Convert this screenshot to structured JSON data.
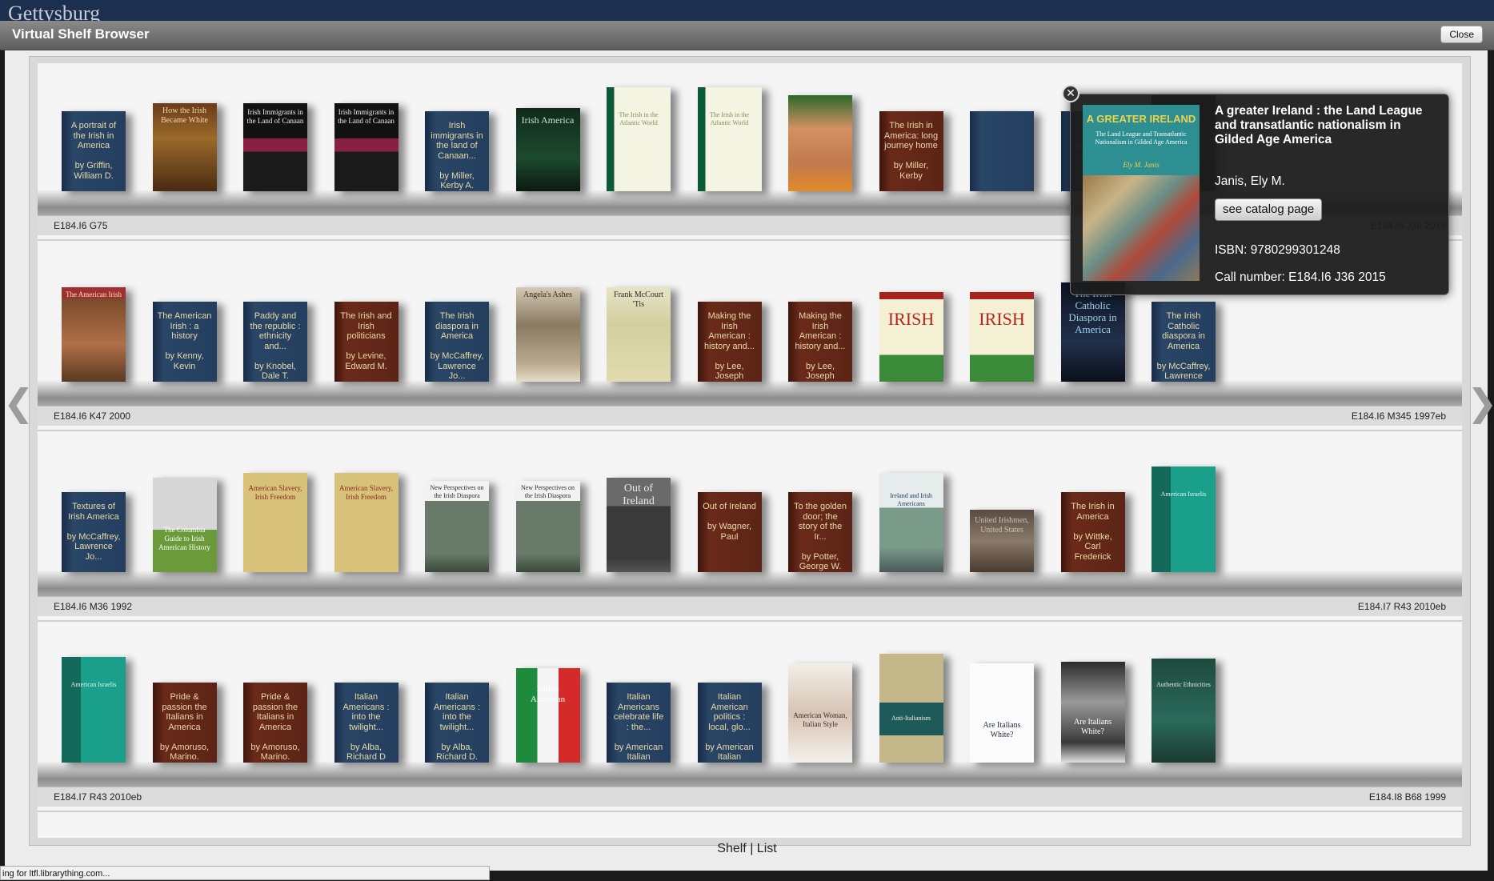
{
  "header": {
    "brand": "Gettysburg"
  },
  "dialog": {
    "title": "Virtual Shelf Browser",
    "close_label": "Close"
  },
  "shelves": [
    {
      "left_callno": "E184.I6 G75",
      "right_callno": "E184.I6 J36 2015",
      "books": [
        {
          "text": "A portrait of the Irish in America\n\nby Griffin, William D.",
          "color": "blue"
        },
        {
          "cover": "How the Irish Became White",
          "style": "brown-photo"
        },
        {
          "cover": "Irish Immigrants in the Land of Canaan",
          "style": "dark-band"
        },
        {
          "cover": "Irish Immigrants in the Land of Canaan",
          "style": "dark-band"
        },
        {
          "text": "Irish immigrants in the land of Canaan...\n\nby Miller, Kerby A.",
          "color": "blue"
        },
        {
          "cover": "Irish America",
          "style": "green-dark"
        },
        {
          "cover": "The Irish in the Atlantic World",
          "style": "cream-green"
        },
        {
          "cover": "The Irish in the Atlantic World",
          "style": "cream-green"
        },
        {
          "cover": "",
          "style": "tattoo"
        },
        {
          "text": "The Irish in America: long journey home\n\nby Miller, Kerby",
          "color": "red"
        },
        {
          "text": "",
          "color": "blue"
        },
        {
          "text": "Irish\n\nby Miller, Kerby",
          "color": "blue"
        },
        {
          "cover": "",
          "style": "dark-photo"
        }
      ]
    },
    {
      "left_callno": "E184.I6 K47 2000",
      "right_callno": "E184.I6 M345 1997eb",
      "books": [
        {
          "cover": "The American Irish",
          "style": "sepia-painting"
        },
        {
          "text": "The American Irish : a history\n\nby Kenny, Kevin",
          "color": "blue"
        },
        {
          "text": "Paddy and the republic : ethnicity and...\n\nby Knobel, Dale T.",
          "color": "blue"
        },
        {
          "text": "The Irish and Irish politicians\n\nby Levine, Edward M.",
          "color": "red"
        },
        {
          "text": "The Irish diaspora in America\n\nby McCaffrey, Lawrence Jo...",
          "color": "blue"
        },
        {
          "cover": "Angela's Ashes",
          "style": "ashes"
        },
        {
          "cover": "Frank McCourt 'Tis",
          "style": "tis"
        },
        {
          "text": "Making the Irish American : history and...\n\nby Lee, Joseph",
          "color": "red"
        },
        {
          "text": "Making the Irish American : history and...\n\nby Lee, Joseph",
          "color": "red"
        },
        {
          "cover": "IRISH",
          "style": "irish-flowers"
        },
        {
          "cover": "IRISH",
          "style": "irish-flowers"
        },
        {
          "cover": "The Irish Catholic Diaspora in America",
          "style": "catholic"
        },
        {
          "text": "The Irish Catholic diaspora in America\n\nby McCaffrey, Lawrence",
          "color": "blue"
        }
      ]
    },
    {
      "left_callno": "E184.I6 M36 1992",
      "right_callno": "E184.I7 R43 2010eb",
      "books": [
        {
          "text": "Textures of Irish America\n\nby McCaffrey, Lawrence Jo...",
          "color": "blue"
        },
        {
          "cover": "The Columbia Guide to Irish American History",
          "style": "columbia"
        },
        {
          "cover": "American Slavery, Irish Freedom",
          "style": "yellow-book"
        },
        {
          "cover": "American Slavery, Irish Freedom",
          "style": "yellow-book"
        },
        {
          "cover": "New Perspectives on the Irish Diaspora",
          "style": "diaspora"
        },
        {
          "cover": "New Perspectives on the Irish Diaspora",
          "style": "diaspora"
        },
        {
          "cover": "Out of Ireland",
          "style": "out-of-ireland"
        },
        {
          "text": "Out of Ireland\n\nby Wagner, Paul",
          "color": "red"
        },
        {
          "text": "To the golden door; the story of the Ir...\n\nby Potter, George W.",
          "color": "red"
        },
        {
          "cover": "Ireland and Irish Americans",
          "style": "ireland-ia"
        },
        {
          "cover": "United Irishmen, United States",
          "style": "united"
        },
        {
          "text": "The Irish in America\n\nby Wittke, Carl Frederick",
          "color": "red"
        },
        {
          "cover": "American Israelis",
          "style": "teal"
        }
      ]
    },
    {
      "left_callno": "E184.I7 R43 2010eb",
      "right_callno": "E184.I8 B68 1999",
      "books": [
        {
          "cover": "American Israelis",
          "style": "teal"
        },
        {
          "text": "Pride & passion the Italians in America\n\nby Amoruso, Marino.",
          "color": "red"
        },
        {
          "text": "Pride & passion the Italians in America\n\nby Amoruso, Marino.",
          "color": "red"
        },
        {
          "text": "Italian Americans : into the twilight...\n\nby Alba, Richard D",
          "color": "blue"
        },
        {
          "text": "Italian Americans : into the twilight...\n\nby Alba, Richard D.",
          "color": "blue"
        },
        {
          "cover": "Italian American",
          "style": "italian-flag"
        },
        {
          "text": "Italian Americans celebrate life : the...\n\nby American Italian Histor...",
          "color": "blue"
        },
        {
          "text": "Italian American politics : local, glo...\n\nby American Italian Histor...",
          "color": "blue"
        },
        {
          "cover": "American Woman, Italian Style",
          "style": "woman"
        },
        {
          "cover": "Anti-Italianism",
          "style": "anti-ital"
        },
        {
          "cover": "Are Italians White?",
          "style": "white-book"
        },
        {
          "cover": "Are Italians White?",
          "style": "bw-photo"
        },
        {
          "cover": "Authentic Ethnicities",
          "style": "authentic"
        }
      ]
    }
  ],
  "popup": {
    "cover_title": "A GREATER IRELAND",
    "cover_subtitle": "The Land League and Transatlantic Nationalism in Gilded Age America",
    "cover_author": "Ely M. Janis",
    "title": "A greater Ireland : the Land League and transatlantic nationalism in Gilded Age America",
    "author": "Janis, Ely M.",
    "button": "see catalog page",
    "isbn": "ISBN: 9780299301248",
    "call_number": "Call number: E184.I6 J36 2015"
  },
  "footer": {
    "shelf": "Shelf",
    "sep": " | ",
    "list": "List"
  },
  "status": "ing for ltfl.librarything.com..."
}
